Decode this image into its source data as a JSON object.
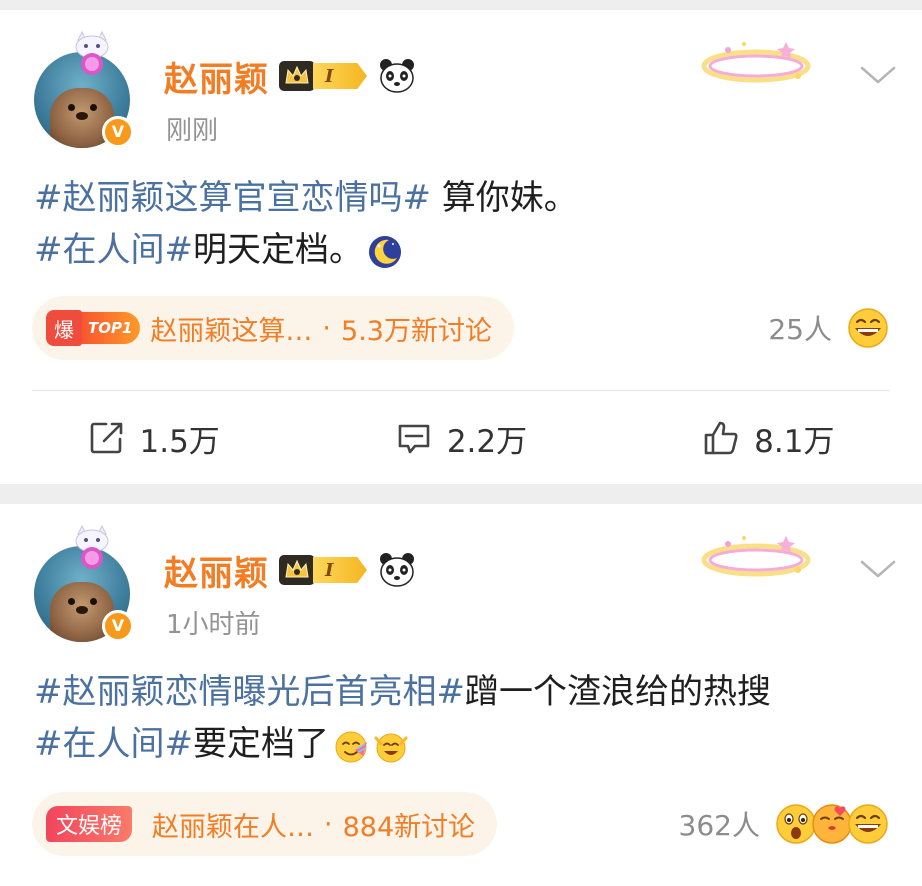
{
  "posts": [
    {
      "username": "赵丽颖",
      "level": "I",
      "timestamp": "刚刚",
      "lines": [
        {
          "topic": "#赵丽颖这算官宣恋情吗#",
          "text": " 算你妹。"
        },
        {
          "topic": "#在人间#",
          "text": "明天定档。"
        }
      ],
      "inline_emojis": [
        "moon-emoji"
      ],
      "hot": {
        "badge_main": "爆",
        "badge_rank": "TOP1",
        "topic": "赵丽颖这算…",
        "separator": "·",
        "discussion": "5.3万新讨论"
      },
      "reactions": {
        "count": "25人",
        "emojis": [
          "laugh-emoji"
        ]
      },
      "actions": {
        "repost": "1.5万",
        "comment": "2.2万",
        "like": "8.1万"
      }
    },
    {
      "username": "赵丽颖",
      "level": "I",
      "timestamp": "1小时前",
      "lines": [
        {
          "topic": "#赵丽颖恋情曝光后首亮相#",
          "text": "蹭一个渣浪给的热搜"
        },
        {
          "topic": "#在人间#",
          "text": "要定档了"
        }
      ],
      "inline_emojis": [
        "party-emoji",
        "cheer-emoji"
      ],
      "hot": {
        "badge_main": "文娱榜",
        "topic": "赵丽颖在人…",
        "separator": "·",
        "discussion": "884新讨论"
      },
      "reactions": {
        "count": "362人",
        "emojis": [
          "surprised-emoji",
          "kiss-emoji",
          "laugh-emoji"
        ]
      }
    }
  ],
  "colors": {
    "username": "#f27d24",
    "topic_link": "#4b71a0",
    "timestamp": "#939393",
    "hot_pill_bg": "#fdf4e9"
  }
}
